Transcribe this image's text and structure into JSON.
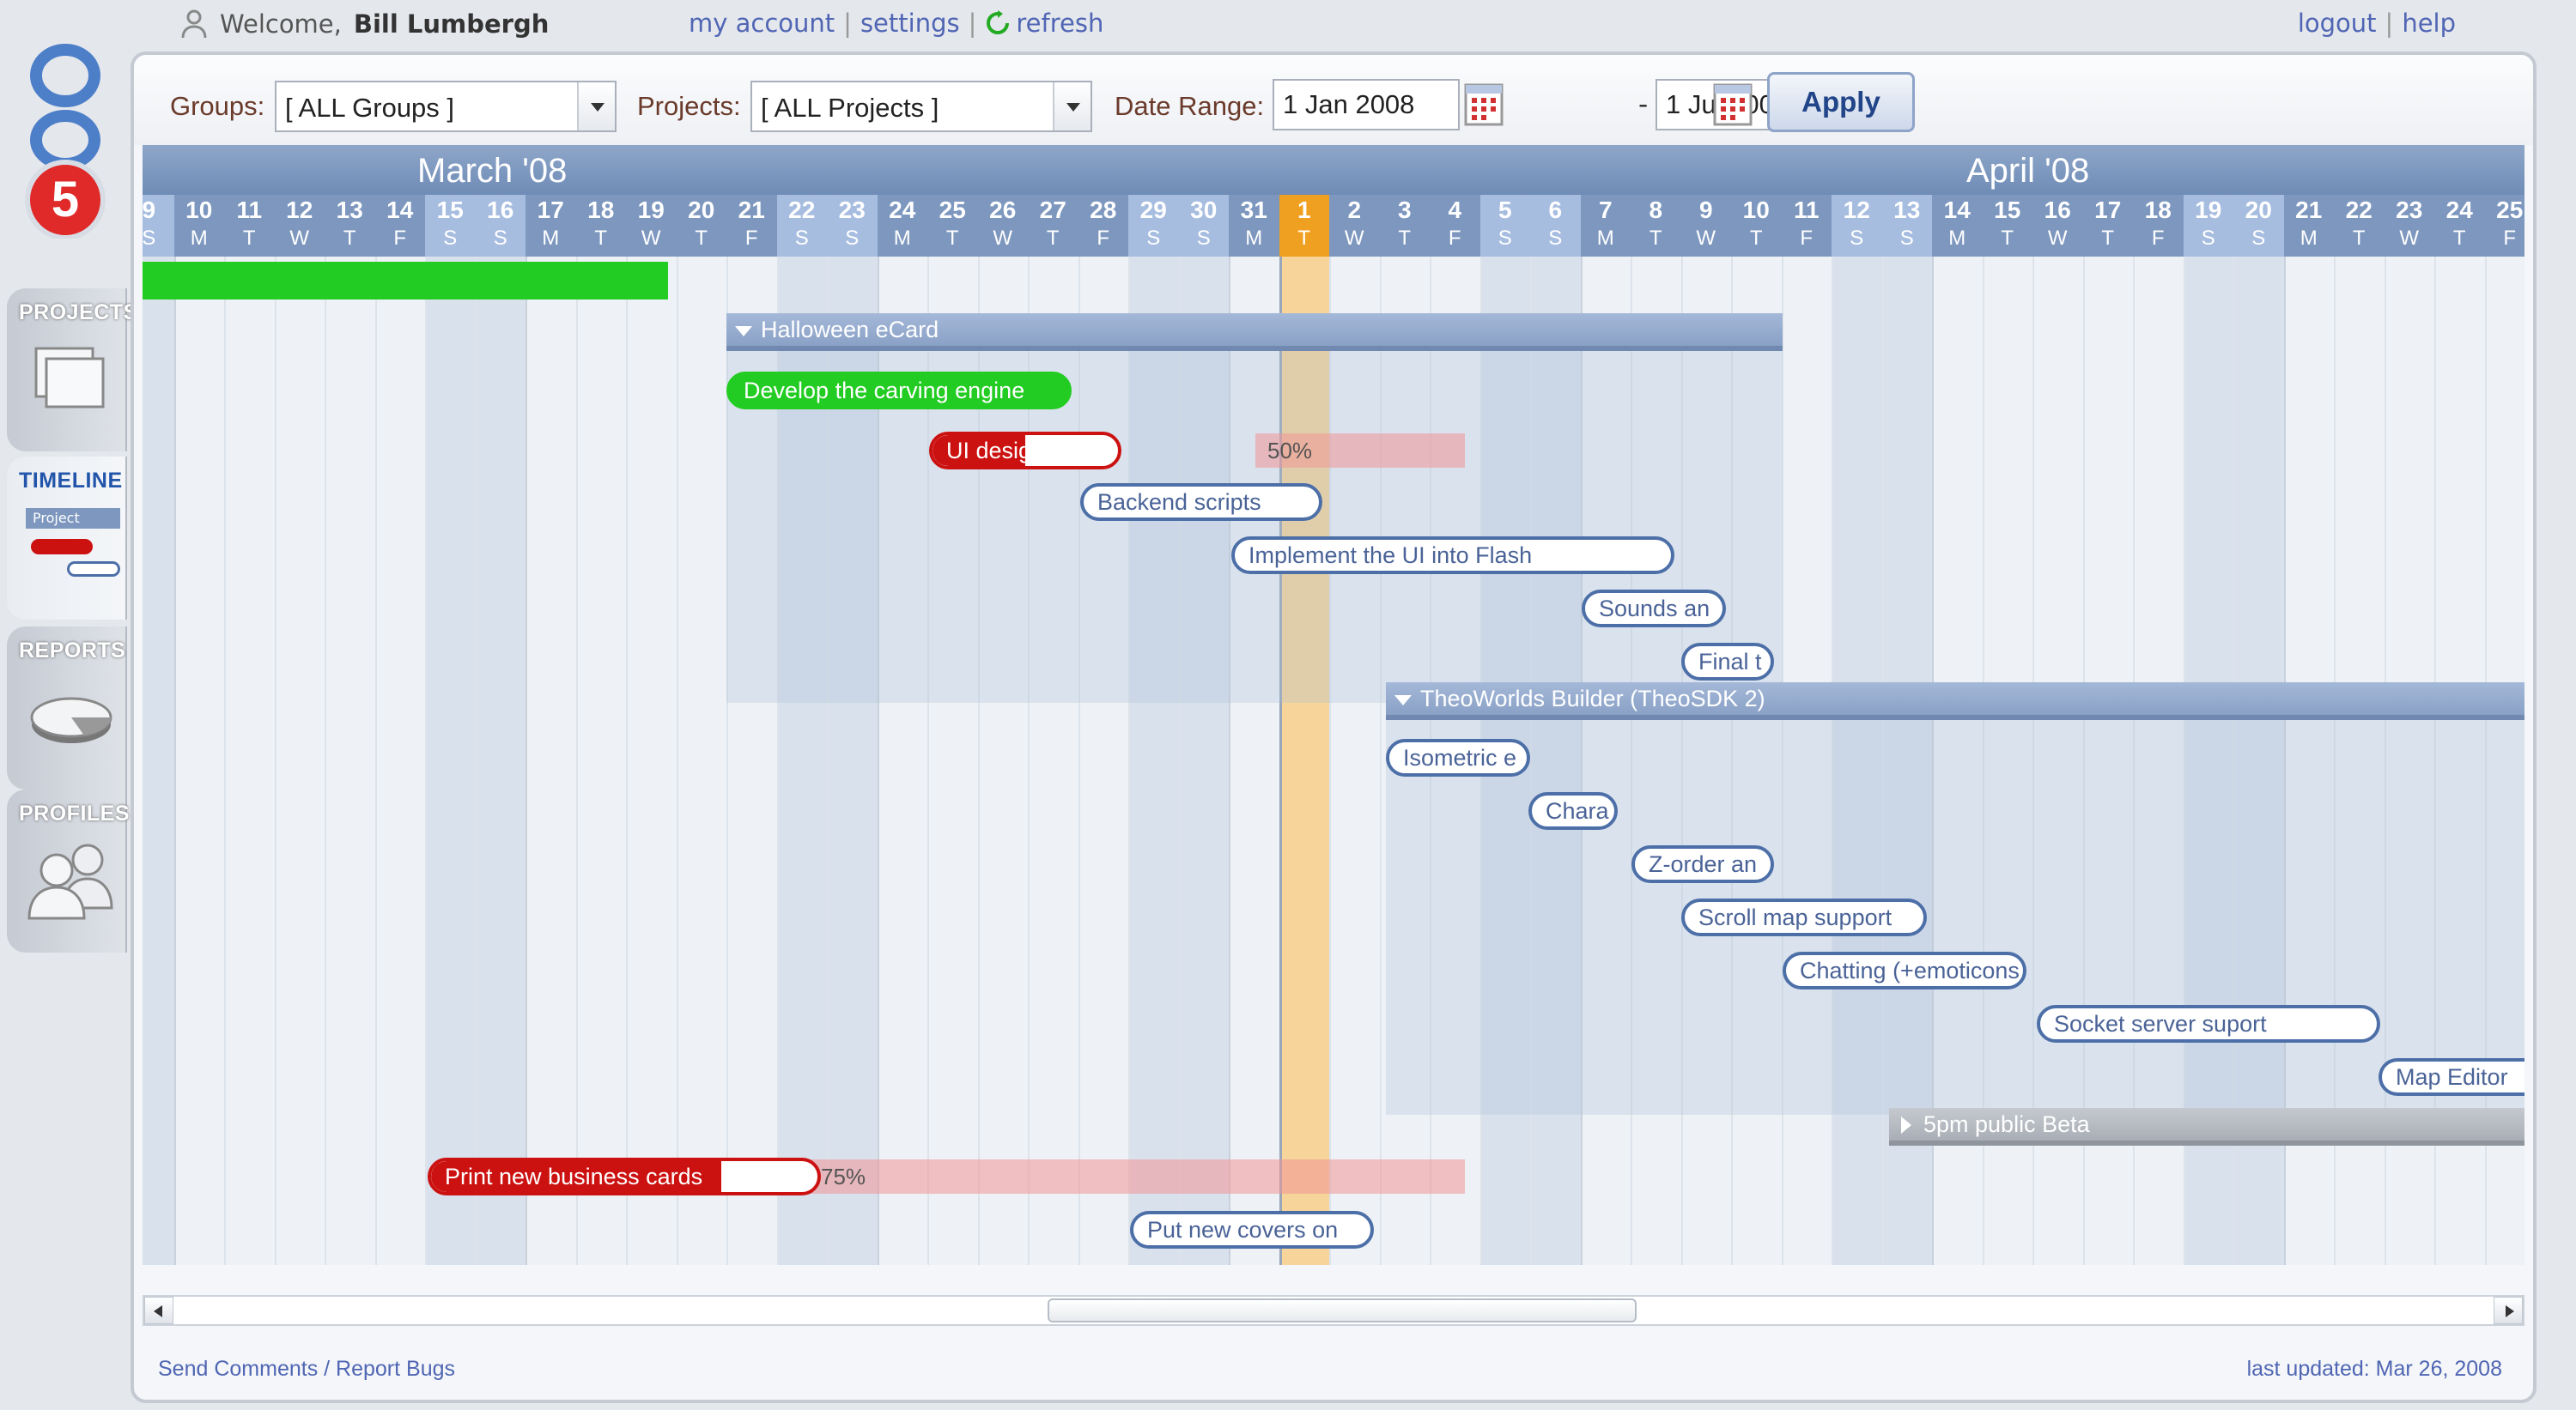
{
  "header": {
    "welcome_prefix": "Welcome,",
    "user_name": "Bill Lumbergh",
    "my_account": "my account",
    "settings": "settings",
    "refresh": "refresh",
    "logout": "logout",
    "help": "help",
    "sep": "|"
  },
  "sidebar": {
    "logo_text": "5pm",
    "tabs": [
      {
        "label": "PROJECTS",
        "icon": "folders-icon",
        "active": false
      },
      {
        "label": "TIMELINE",
        "icon": "timeline-icon",
        "active": true
      },
      {
        "label": "REPORTS",
        "icon": "pie-chart-icon",
        "active": false
      },
      {
        "label": "PROFILES",
        "icon": "people-icon",
        "active": false
      }
    ],
    "timeline_mini_label": "Project"
  },
  "filters": {
    "groups_label": "Groups:",
    "groups_value": "[ ALL Groups ]",
    "projects_label": "Projects:",
    "projects_value": "[ ALL Projects ]",
    "date_range_label": "Date Range:",
    "date_from": "1 Jan 2008",
    "date_sep": "-",
    "date_to": "1 Jul 2008",
    "apply": "Apply"
  },
  "timeline": {
    "months": [
      {
        "label": "March '08"
      },
      {
        "label": "April '08"
      }
    ],
    "days": [
      {
        "d": "9",
        "w": "S"
      },
      {
        "d": "10",
        "w": "M"
      },
      {
        "d": "11",
        "w": "T"
      },
      {
        "d": "12",
        "w": "W"
      },
      {
        "d": "13",
        "w": "T"
      },
      {
        "d": "14",
        "w": "F"
      },
      {
        "d": "15",
        "w": "S"
      },
      {
        "d": "16",
        "w": "S"
      },
      {
        "d": "17",
        "w": "M"
      },
      {
        "d": "18",
        "w": "T"
      },
      {
        "d": "19",
        "w": "W"
      },
      {
        "d": "20",
        "w": "T"
      },
      {
        "d": "21",
        "w": "F"
      },
      {
        "d": "22",
        "w": "S"
      },
      {
        "d": "23",
        "w": "S"
      },
      {
        "d": "24",
        "w": "M"
      },
      {
        "d": "25",
        "w": "T"
      },
      {
        "d": "26",
        "w": "W"
      },
      {
        "d": "27",
        "w": "T"
      },
      {
        "d": "28",
        "w": "F"
      },
      {
        "d": "29",
        "w": "S"
      },
      {
        "d": "30",
        "w": "S"
      },
      {
        "d": "31",
        "w": "M"
      },
      {
        "d": "1",
        "w": "T"
      },
      {
        "d": "2",
        "w": "W"
      },
      {
        "d": "3",
        "w": "T"
      },
      {
        "d": "4",
        "w": "F"
      },
      {
        "d": "5",
        "w": "S"
      },
      {
        "d": "6",
        "w": "S"
      },
      {
        "d": "7",
        "w": "M"
      },
      {
        "d": "8",
        "w": "T"
      },
      {
        "d": "9",
        "w": "W"
      },
      {
        "d": "10",
        "w": "T"
      },
      {
        "d": "11",
        "w": "F"
      },
      {
        "d": "12",
        "w": "S"
      },
      {
        "d": "13",
        "w": "S"
      },
      {
        "d": "14",
        "w": "M"
      },
      {
        "d": "15",
        "w": "T"
      },
      {
        "d": "16",
        "w": "W"
      },
      {
        "d": "17",
        "w": "T"
      },
      {
        "d": "18",
        "w": "F"
      },
      {
        "d": "19",
        "w": "S"
      },
      {
        "d": "20",
        "w": "S"
      },
      {
        "d": "21",
        "w": "M"
      },
      {
        "d": "22",
        "w": "T"
      },
      {
        "d": "23",
        "w": "W"
      },
      {
        "d": "24",
        "w": "T"
      },
      {
        "d": "25",
        "w": "F"
      }
    ],
    "today": "1 Apr",
    "groups": [
      {
        "label": "Halloween eCard",
        "expanded": true
      },
      {
        "label": "TheoWorlds Builder (TheoSDK 2)",
        "expanded": true
      },
      {
        "label": "5pm public Beta",
        "expanded": false
      }
    ],
    "tasks": [
      {
        "label": "Develop the carving engine",
        "status": "complete"
      },
      {
        "label": "UI design",
        "status": "overdue",
        "progress": "50%"
      },
      {
        "label": "Backend scripts",
        "status": "open"
      },
      {
        "label": "Implement the UI into Flash",
        "status": "open"
      },
      {
        "label": "Sounds an",
        "status": "open"
      },
      {
        "label": "Final t",
        "status": "open"
      },
      {
        "label": "Isometric e",
        "status": "open"
      },
      {
        "label": "Chara",
        "status": "open"
      },
      {
        "label": "Z-order an",
        "status": "open"
      },
      {
        "label": "Scroll map support",
        "status": "open"
      },
      {
        "label": "Chatting (+emoticons",
        "status": "open"
      },
      {
        "label": "Socket server suport",
        "status": "open"
      },
      {
        "label": "Map Editor",
        "status": "open"
      },
      {
        "label": "Print new business cards",
        "status": "overdue",
        "progress": "75%"
      },
      {
        "label": "Put new covers on",
        "status": "open"
      }
    ]
  },
  "footer": {
    "feedback": "Send Comments / Report Bugs",
    "updated": "last updated: Mar 26, 2008"
  },
  "colors": {
    "complete": "#22cc22",
    "overdue": "#cc1111",
    "today": "#f0a020",
    "link": "#5066b4"
  }
}
